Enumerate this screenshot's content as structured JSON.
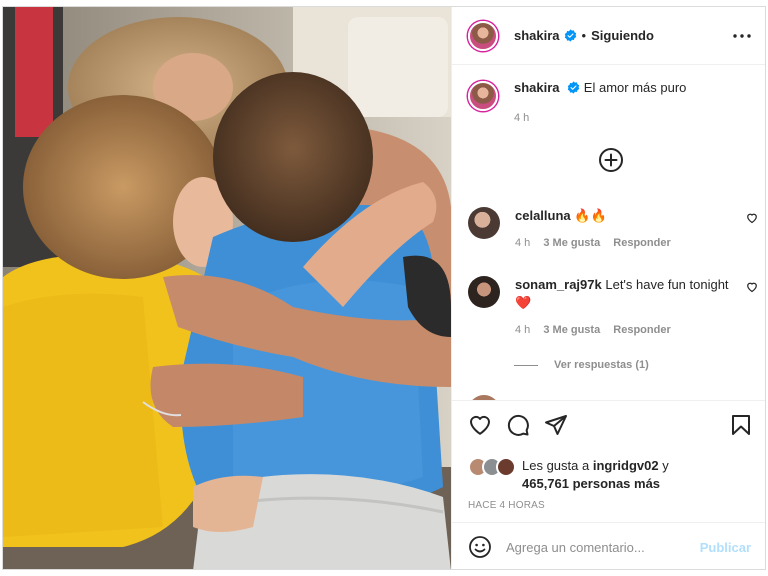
{
  "post": {
    "author": "shakira",
    "follow_status": "Siguiendo",
    "separator": "•",
    "caption": "El amor más puro",
    "caption_time": "4 h"
  },
  "comments": [
    {
      "user": "celalluna",
      "text": "🔥🔥",
      "time": "4 h",
      "likes": "3 Me gusta",
      "reply": "Responder"
    },
    {
      "user": "sonam_raj97k",
      "text": "Let's have fun tonight ❤️",
      "time": "4 h",
      "likes": "3 Me gusta",
      "reply": "Responder"
    }
  ],
  "view_replies": "Ver respuestas (1)",
  "likes": {
    "prefix": "Les gusta a",
    "user": "ingridgv02",
    "joiner": "y",
    "count": "465,761 personas más"
  },
  "posted_ago": "HACE 4 HORAS",
  "comment_box": {
    "placeholder": "Agrega un comentario...",
    "publish_label": "Publicar"
  },
  "icons": {
    "more": "more-options-icon",
    "verified": "verified-badge-icon",
    "load_more": "plus-circle-icon",
    "like": "heart-icon",
    "comment": "comment-bubble-icon",
    "share": "paper-plane-icon",
    "save": "bookmark-icon",
    "emoji": "smiley-icon"
  },
  "colors": {
    "verified": "#0095f6",
    "publish_disabled": "#b2dffc",
    "secondary_text": "#8e8e8e",
    "primary_text": "#262626"
  }
}
